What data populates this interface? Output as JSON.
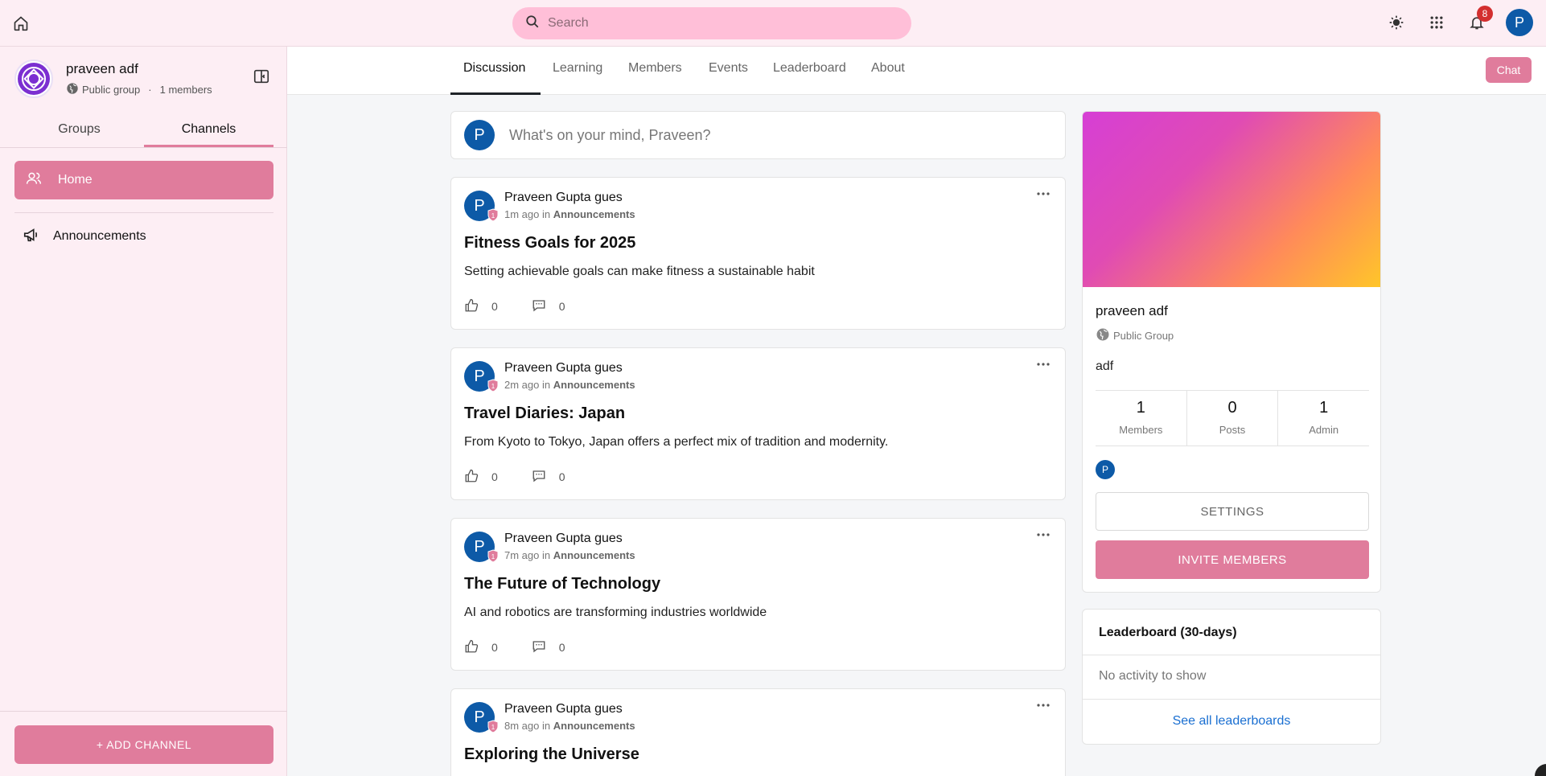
{
  "topbar": {
    "search_placeholder": "Search",
    "notification_count": "8",
    "user_initial": "P"
  },
  "sidebar": {
    "group_name": "praveen adf",
    "group_visibility": "Public group",
    "group_separator": "·",
    "group_members": "1 members",
    "tabs": [
      {
        "label": "Groups",
        "active": false
      },
      {
        "label": "Channels",
        "active": true
      }
    ],
    "home_label": "Home",
    "announcements_label": "Announcements",
    "add_channel_label": "+ ADD CHANNEL"
  },
  "main": {
    "tabs": [
      {
        "label": "Discussion",
        "active": true
      },
      {
        "label": "Learning",
        "active": false
      },
      {
        "label": "Members",
        "active": false
      },
      {
        "label": "Events",
        "active": false
      },
      {
        "label": "Leaderboard",
        "active": false
      },
      {
        "label": "About",
        "active": false
      }
    ],
    "chat_label": "Chat"
  },
  "composer": {
    "avatar_initial": "P",
    "placeholder": "What's on your mind, Praveen?"
  },
  "posts": [
    {
      "author": "Praveen Gupta gues",
      "time": "1m ago",
      "in_word": "in",
      "channel": "Announcements",
      "title": "Fitness Goals for 2025",
      "body": "Setting achievable goals can make fitness a sustainable habit",
      "likes": "0",
      "comments": "0",
      "avatar_initial": "P",
      "badge": "1"
    },
    {
      "author": "Praveen Gupta gues",
      "time": "2m ago",
      "in_word": "in",
      "channel": "Announcements",
      "title": "Travel Diaries: Japan",
      "body": "From Kyoto to Tokyo, Japan offers a perfect mix of tradition and modernity.",
      "likes": "0",
      "comments": "0",
      "avatar_initial": "P",
      "badge": "1"
    },
    {
      "author": "Praveen Gupta gues",
      "time": "7m ago",
      "in_word": "in",
      "channel": "Announcements",
      "title": "The Future of Technology",
      "body": "AI and robotics are transforming industries worldwide",
      "likes": "0",
      "comments": "0",
      "avatar_initial": "P",
      "badge": "1"
    },
    {
      "author": "Praveen Gupta gues",
      "time": "8m ago",
      "in_word": "in",
      "channel": "Announcements",
      "title": "Exploring the Universe",
      "body": "",
      "likes": "",
      "comments": "",
      "avatar_initial": "P",
      "badge": "1"
    }
  ],
  "info": {
    "name": "praveen adf",
    "type": "Public Group",
    "description": "adf",
    "stats": [
      {
        "value": "1",
        "label": "Members"
      },
      {
        "value": "0",
        "label": "Posts"
      },
      {
        "value": "1",
        "label": "Admin"
      }
    ],
    "member_initial": "P",
    "settings_label": "SETTINGS",
    "invite_label": "INVITE MEMBERS"
  },
  "leaderboard": {
    "title": "Leaderboard (30-days)",
    "empty_text": "No activity to show",
    "link_label": "See all leaderboards"
  },
  "colors": {
    "accent": "#e07c9c",
    "topbar_bg": "#fdeef4",
    "search_bg": "#ffbfd8",
    "avatar": "#0d5aa7",
    "link": "#1a6fd1"
  }
}
